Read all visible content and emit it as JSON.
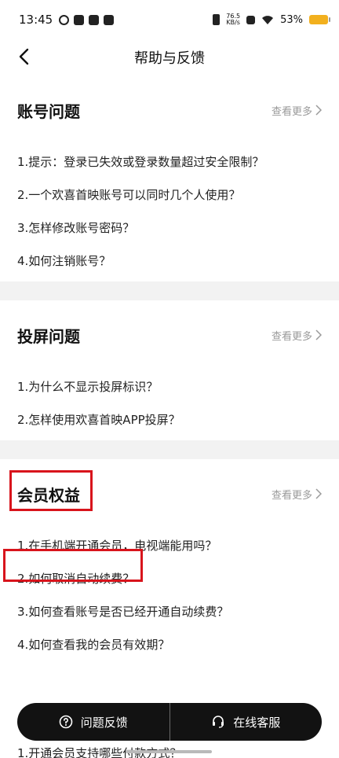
{
  "status_bar": {
    "time": "13:45",
    "net_speed": "76.5",
    "net_unit": "KB/s",
    "battery": "53%"
  },
  "nav": {
    "title": "帮助与反馈"
  },
  "sections": [
    {
      "title": "账号问题",
      "more": "查看更多",
      "questions": [
        "1.提示：登录已失效或登录数量超过安全限制？",
        "2.一个欢喜首映账号可以同时几个人使用？",
        "3.怎样修改账号密码？",
        "4.如何注销账号？"
      ]
    },
    {
      "title": "投屏问题",
      "more": "查看更多",
      "questions": [
        "1.为什么不显示投屏标识？",
        "2.怎样使用欢喜首映APP投屏？"
      ]
    },
    {
      "title": "会员权益",
      "more": "查看更多",
      "questions": [
        "1.在手机端开通会员，电视端能用吗？",
        "2.如何取消自动续费？",
        "3.如何查看账号是否已经开通自动续费？",
        "4.如何查看我的会员有效期？"
      ]
    }
  ],
  "partial_section": {
    "question": "1.开通会员支持哪些付款方式？"
  },
  "bottom_bar": {
    "feedback_label": "问题反馈",
    "service_label": "在线客服"
  },
  "colors": {
    "highlight": "#d8141c",
    "bar_bg": "#121212",
    "battery": "#f2b01e"
  }
}
